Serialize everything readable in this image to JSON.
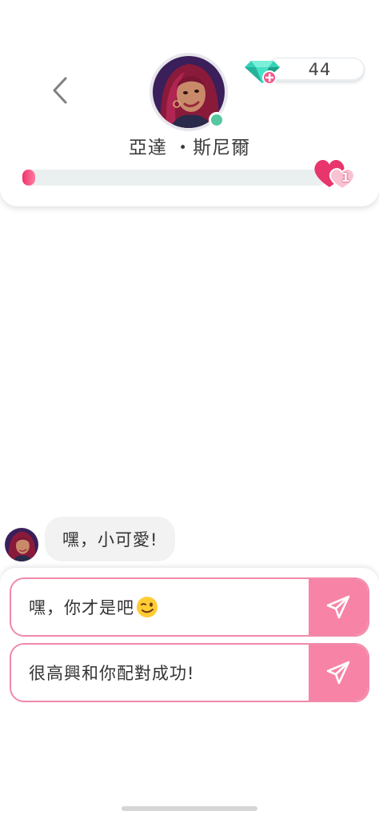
{
  "header": {
    "back_icon": "chevron-left-icon",
    "character_name": "亞達 ・斯尼爾",
    "online": true,
    "gems": {
      "count": "44",
      "icon": "gem-plus-icon"
    },
    "affection": {
      "level": "1",
      "progress": 0.04,
      "icon": "hearts-icon"
    }
  },
  "chat": {
    "messages": [
      {
        "from": "character",
        "text": "嘿，小可愛!"
      }
    ]
  },
  "replies": [
    {
      "text": "嘿，你才是吧",
      "emoji": "winking-face",
      "send_icon": "send-icon"
    },
    {
      "text": "很高興和你配對成功!",
      "send_icon": "send-icon"
    }
  ],
  "colors": {
    "accent_pink": "#f783a6",
    "progress_pink": "#ff5d84",
    "online_green": "#56c8a1",
    "gem_teal": "#3fd6b8"
  }
}
